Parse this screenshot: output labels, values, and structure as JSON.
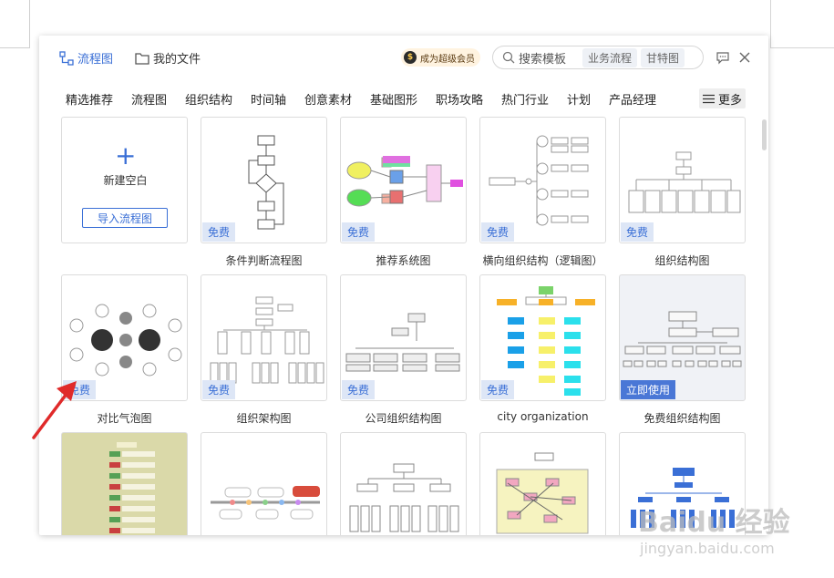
{
  "header": {
    "tab_flowchart": "流程图",
    "tab_files": "我的文件",
    "vip_label": "成为超级会员",
    "search_placeholder": "搜索模板",
    "chips": [
      "业务流程",
      "甘特图"
    ],
    "icons": {
      "flowchart": "flowchart-icon",
      "folder": "folder-icon",
      "search": "search-icon",
      "chat": "chat-icon",
      "close": "close-icon"
    }
  },
  "categories": [
    "精选推荐",
    "流程图",
    "组织结构",
    "时间轴",
    "创意素材",
    "基础图形",
    "职场攻略",
    "热门行业",
    "计划",
    "产品经理"
  ],
  "more_label": "更多",
  "new_blank": {
    "label": "新建空白",
    "import_label": "导入流程图"
  },
  "templates": [
    {
      "label": "条件判断流程图",
      "badge": "免费"
    },
    {
      "label": "推荐系统图",
      "badge": "免费"
    },
    {
      "label": "横向组织结构（逻辑图）",
      "badge": "免费"
    },
    {
      "label": "组织结构图",
      "badge": "免费"
    },
    {
      "label": "对比气泡图",
      "badge": "免费"
    },
    {
      "label": "组织架构图",
      "badge": "免费"
    },
    {
      "label": "公司组织结构图",
      "badge": "免费"
    },
    {
      "label": "city organization",
      "badge": "免费"
    },
    {
      "label": "免费组织结构图",
      "badge": "立即使用"
    }
  ],
  "watermark": {
    "main": "Baidu 经验",
    "sub": "jingyan.baidu.com"
  },
  "colors": {
    "accent": "#3a6fd6",
    "badge_bg": "#dde6f6"
  }
}
